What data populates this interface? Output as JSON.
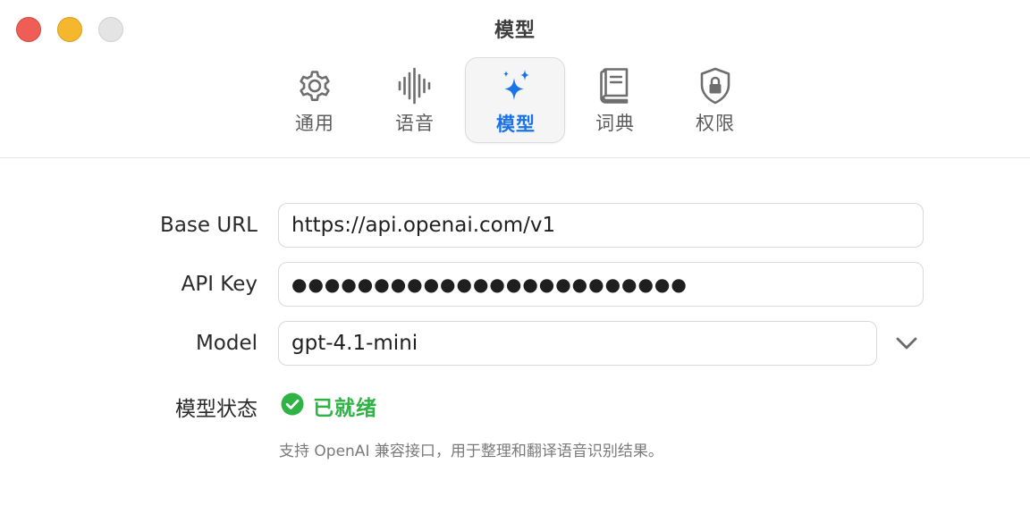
{
  "window": {
    "title": "模型"
  },
  "toolbar": {
    "tabs": [
      {
        "label": "通用",
        "icon": "gear-icon",
        "active": false
      },
      {
        "label": "语音",
        "icon": "waveform-icon",
        "active": false
      },
      {
        "label": "模型",
        "icon": "sparkles-icon",
        "active": true
      },
      {
        "label": "词典",
        "icon": "book-icon",
        "active": false
      },
      {
        "label": "权限",
        "icon": "lock-shield-icon",
        "active": false
      }
    ],
    "active_color": "#1a73e8"
  },
  "form": {
    "base_url": {
      "label": "Base URL",
      "value": "https://api.openai.com/v1"
    },
    "api_key": {
      "label": "API Key",
      "value": "●●●●●●●●●●●●●●●●●●●●●●●●"
    },
    "model": {
      "label": "Model",
      "value": "gpt-4.1-mini"
    },
    "status": {
      "label": "模型状态",
      "value": "已就绪",
      "color": "#2fb344"
    },
    "hint": "支持 OpenAI 兼容接口，用于整理和翻译语音识别结果。"
  },
  "traffic_lights": {
    "close_color": "#ee5e56",
    "minimize_color": "#f5b72d",
    "zoom_color": "#e4e4e4"
  }
}
